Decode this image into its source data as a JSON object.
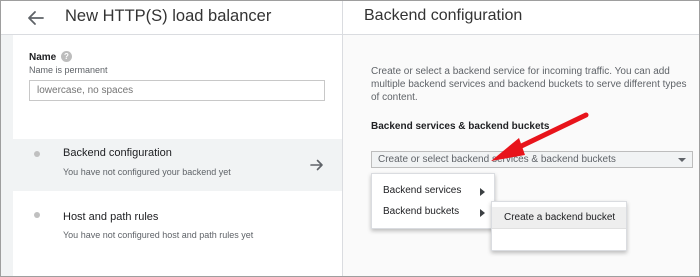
{
  "left_panel": {
    "title": "New HTTP(S) load balancer",
    "name_field": {
      "label": "Name",
      "hint": "Name is permanent",
      "placeholder": "lowercase, no spaces",
      "value": ""
    },
    "steps": [
      {
        "title": "Backend configuration",
        "subtitle": "You have not configured your backend yet",
        "active": true
      },
      {
        "title": "Host and path rules",
        "subtitle": "You have not configured host and path rules yet",
        "active": false
      }
    ]
  },
  "right_panel": {
    "title": "Backend configuration",
    "description": "Create or select a backend service for incoming traffic. You can add multiple backend services and backend buckets to serve different types of content.",
    "section_label": "Backend services & backend buckets",
    "select": {
      "value": "Create or select backend services & backend buckets"
    },
    "menu": {
      "items": [
        {
          "label": "Backend services"
        },
        {
          "label": "Backend buckets"
        }
      ]
    },
    "submenu": {
      "items": [
        {
          "label": "Create a backend bucket"
        }
      ]
    }
  },
  "colors": {
    "annotation_arrow": "#e8141b",
    "active_step_bg": "#f1f3f4",
    "panel_border": "#dadce0"
  },
  "icons": {
    "back": "arrow-left-icon",
    "help": "help-circle-icon",
    "step_go": "arrow-right-icon",
    "select_caret": "caret-down-icon",
    "submenu": "chevron-right-icon"
  }
}
